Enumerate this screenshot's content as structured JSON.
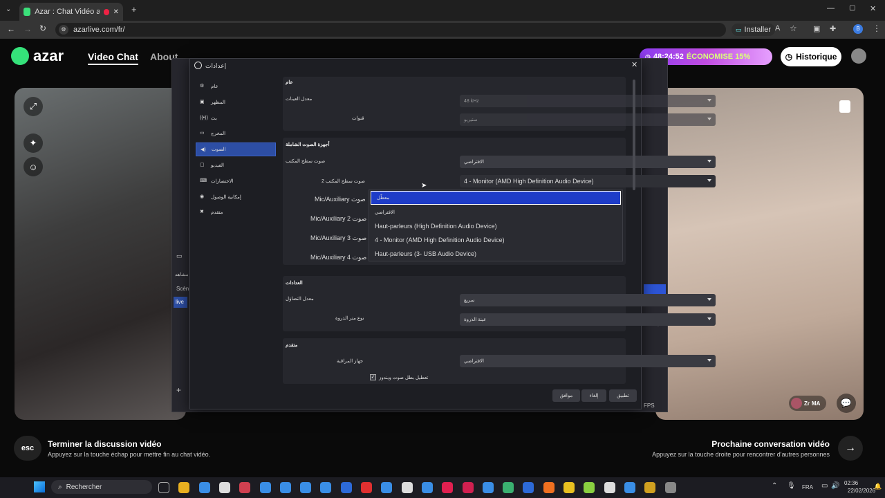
{
  "browser": {
    "tab_title": "Azar : Chat Vidéo avec de",
    "url": "azarlive.com/fr/",
    "install_label": "Installer",
    "profile_letter": "B"
  },
  "azar": {
    "logo": "azar",
    "nav": {
      "video_chat": "Video Chat",
      "about": "About"
    },
    "promo": {
      "time": "48:24:52",
      "text": "ÉCONOMISE 15%"
    },
    "history_label": "Historique",
    "badge": {
      "name": "Zr",
      "country": "MA"
    }
  },
  "obs": {
    "title": "إعدادات",
    "sidebar": [
      {
        "label": "عام",
        "icon": "gear-icon"
      },
      {
        "label": "المظهر",
        "icon": "appearance-icon"
      },
      {
        "label": "بث",
        "icon": "stream-icon"
      },
      {
        "label": "المخرج",
        "icon": "output-icon"
      },
      {
        "label": "الصوت",
        "icon": "audio-icon"
      },
      {
        "label": "الفيديو",
        "icon": "video-icon"
      },
      {
        "label": "الاختصارات",
        "icon": "keyboard-icon"
      },
      {
        "label": "إمكانية الوصول",
        "icon": "accessibility-icon"
      },
      {
        "label": "متقدم",
        "icon": "advanced-icon"
      }
    ],
    "selected_index": 4,
    "general": {
      "header": "عام",
      "sample_rate_label": "معدل العينات",
      "sample_rate_value": "48 kHz",
      "channels_label": "قنوات",
      "channels_value": "ستيريو"
    },
    "devices": {
      "header": "أجهزة الصوت الشاملة",
      "desktop_label": "صوت سطح المكتب",
      "desktop_value": "الافتراضي",
      "desktop2_label": "صوت سطح المكتب 2",
      "desktop2_value": "4 - Monitor (AMD High Definition Audio Device)",
      "mic_label": "Mic/Auxiliary صوت",
      "mic2_label": "Mic/Auxiliary 2 صوت",
      "mic3_label": "Mic/Auxiliary 3 صوت",
      "mic4_label": "Mic/Auxiliary 4 صوت",
      "options": [
        "معطّل",
        "الافتراضي",
        "Haut-parleurs (High Definition Audio Device)",
        "4 - Monitor (AMD High Definition Audio Device)",
        "Haut-parleurs (3- USB Audio Device)"
      ]
    },
    "meters": {
      "header": "العدادات",
      "decay_label": "معدل التضاؤل",
      "decay_value": "سريع",
      "peak_label": "نوع متر الذروة",
      "peak_value": "عينة الذروة"
    },
    "advanced": {
      "header": "متقدم",
      "monitor_label": "جهاز المراقبة",
      "monitor_value": "الافتراضي",
      "ducking_label": "تعطيل بطل صوت ويندوز"
    },
    "buttons": {
      "ok": "موافق",
      "cancel": "إلغاء",
      "apply": "تطبيق"
    },
    "bg": {
      "scenes": "Scèn",
      "live": "live",
      "source": "مشاهد",
      "fps": "FPS"
    }
  },
  "bottom": {
    "esc_key": "esc",
    "end_title": "Terminer la discussion vidéo",
    "end_sub": "Appuyez sur la touche échap pour mettre fin au chat vidéo.",
    "next_title": "Prochaine conversation vidéo",
    "next_sub": "Appuyez sur la touche droite pour rencontrer d'autres personnes"
  },
  "taskbar": {
    "search": "Rechercher",
    "lang": "FRA",
    "time": "02:36",
    "date": "22/02/2026"
  }
}
